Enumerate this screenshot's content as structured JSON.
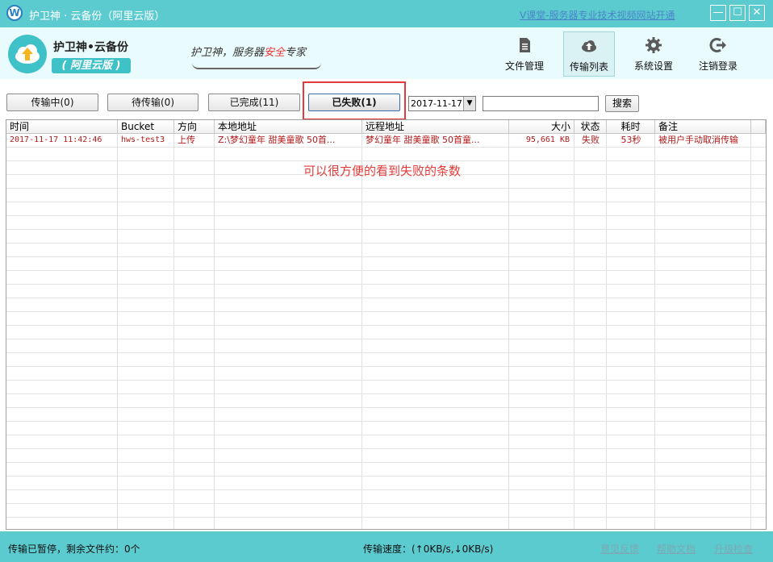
{
  "window": {
    "title": "护卫神 · 云备份（阿里云版）",
    "ad_link": "V课堂-服务器专业技术视频网站开通",
    "icon_letter": "W",
    "controls": {
      "minimize": "—",
      "maximize": "☐",
      "close": "✕"
    }
  },
  "header": {
    "brand_name": "护卫神•云备份",
    "brand_badge": "( 阿里云版 )",
    "slogan_prefix": "护卫神，服务器",
    "slogan_mark": "安全",
    "slogan_suffix": "专家",
    "nav": [
      {
        "label": "文件管理",
        "icon": "file-icon"
      },
      {
        "label": "传输列表",
        "icon": "cloud-upload-icon"
      },
      {
        "label": "系统设置",
        "icon": "gear-icon"
      },
      {
        "label": "注销登录",
        "icon": "logout-icon"
      }
    ]
  },
  "toolbar": {
    "tabs": [
      {
        "label": "传输中(0)"
      },
      {
        "label": "待传输(0)"
      },
      {
        "label": "已完成(11)"
      },
      {
        "label": "已失败(1)"
      }
    ],
    "active_tab": 3,
    "date_value": "2017-11-17",
    "search_value": "",
    "search_label": "搜索"
  },
  "table": {
    "columns": [
      "时间",
      "Bucket",
      "方向",
      "本地地址",
      "远程地址",
      "大小",
      "状态",
      "耗时",
      "备注"
    ],
    "rows": [
      {
        "time": "2017-11-17 11:42:46",
        "bucket": "hws-test3",
        "direction": "上传",
        "local": "Z:\\梦幻童年 甜美童歌 50首...",
        "remote": "梦幻童年 甜美童歌 50首童...",
        "size": "95,661 KB",
        "status": "失败",
        "duration": "53秒",
        "note": "被用户手动取消传输"
      }
    ]
  },
  "annotation": "可以很方便的看到失败的条数",
  "statusbar": {
    "left": "传输已暂停，剩余文件约：0个",
    "speed": "传输速度：(↑0KB/s,↓0KB/s)",
    "links": [
      "意见反馈",
      "帮助文档",
      "升级检查"
    ]
  },
  "colors": {
    "frame": "#5ccbd0",
    "header_bg": "#e9fbfc",
    "row_text": "#b01a1a",
    "highlight": "#e23b3b"
  }
}
